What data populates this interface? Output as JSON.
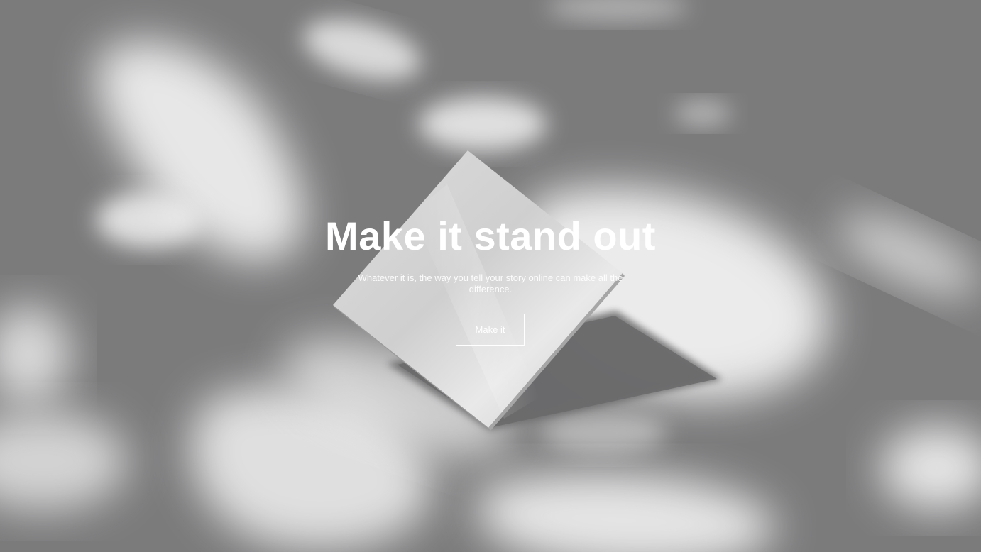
{
  "hero": {
    "title": "Make it stand out",
    "subtitle": "Whatever it is, the way you tell your story online can make all the difference.",
    "cta_label": "Make it"
  },
  "colors": {
    "background": "#7b7b7c",
    "text": "#ffffff",
    "button_border": "#ffffff"
  }
}
